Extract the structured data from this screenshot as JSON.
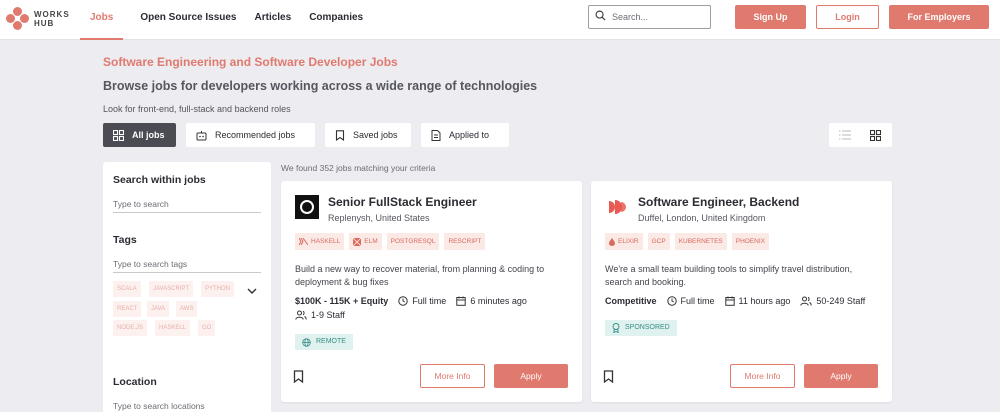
{
  "header": {
    "logo_line1": "WORKS",
    "logo_line2": "HUB",
    "nav": [
      "Jobs",
      "Open Source Issues",
      "Articles",
      "Companies"
    ],
    "search_placeholder": "Search...",
    "signup": "Sign Up",
    "login": "Login",
    "employers": "For Employers"
  },
  "page": {
    "title": "Software Engineering and Software Developer Jobs",
    "subtitle": "Browse jobs for developers working across a wide range of technologies",
    "note": "Look for front-end, full-stack and backend roles"
  },
  "tabs": [
    "All jobs",
    "Recommended jobs",
    "Saved jobs",
    "Applied to"
  ],
  "sidebar": {
    "search_heading": "Search within jobs",
    "search_placeholder": "Type to search",
    "tags_heading": "Tags",
    "tags_placeholder": "Type to search tags",
    "tags": [
      "SCALA",
      "JAVASCRIPT",
      "PYTHON",
      "REACT",
      "JAVA",
      "AWS",
      "NODE.JS",
      "HASKELL",
      "GO"
    ],
    "location_heading": "Location",
    "location_placeholder": "Type to search locations"
  },
  "found_text": "We found 352 jobs matching your criteria",
  "jobs": [
    {
      "title": "Senior FullStack Engineer",
      "location": "Replenysh, United States",
      "tags": [
        "HASKELL",
        "ELM",
        "POSTGRESQL",
        "RESCRIPT"
      ],
      "description": "Build a new way to recover material, from planning & coding to deployment & bug fixes",
      "salary": "$100K - 115K + Equity",
      "type": "Full time",
      "posted": "6 minutes ago",
      "staff": "1-9 Staff",
      "badge": "REMOTE",
      "more_info": "More Info",
      "apply": "Apply"
    },
    {
      "title": "Software Engineer, Backend",
      "location": "Duffel, London, United Kingdom",
      "tags": [
        "ELIXIR",
        "GCP",
        "KUBERNETES",
        "PHOENIX"
      ],
      "description": "We're a small team building tools to simplify travel distribution, search and booking.",
      "salary": "Competitive",
      "type": "Full time",
      "posted": "11 hours ago",
      "staff": "50-249 Staff",
      "badge": "SPONSORED",
      "more_info": "More Info",
      "apply": "Apply"
    }
  ],
  "colors": {
    "accent": "#e07a6e",
    "dark_tab": "#4a4b53",
    "badge_teal": "#3a8e86"
  }
}
